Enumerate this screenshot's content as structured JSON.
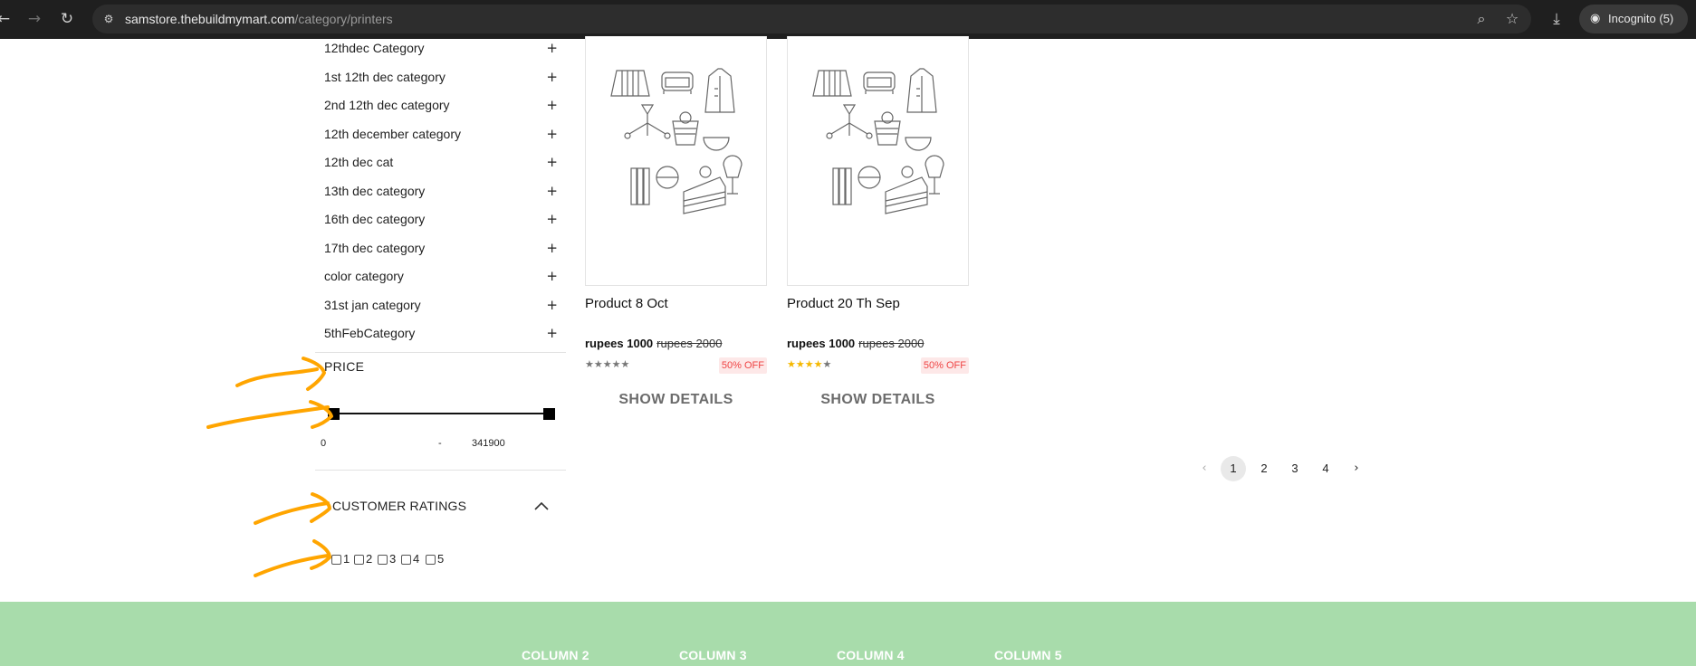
{
  "browser": {
    "url_host": "samstore.thebuildmymart.com",
    "url_path": "/category/printers",
    "incognito_label": "Incognito (5)"
  },
  "sidebar": {
    "categories": [
      {
        "label": "12thdec Category"
      },
      {
        "label": "1st 12th dec category"
      },
      {
        "label": "2nd 12th dec category"
      },
      {
        "label": "12th december category"
      },
      {
        "label": "12th dec cat"
      },
      {
        "label": "13th dec category"
      },
      {
        "label": "16th dec category"
      },
      {
        "label": "17th dec category"
      },
      {
        "label": "color category"
      },
      {
        "label": "31st jan category"
      },
      {
        "label": "5thFebCategory"
      }
    ],
    "expand_symbol": "+",
    "price": {
      "title": "PRICE",
      "min": "0",
      "separator": "-",
      "max": "341900"
    },
    "ratings": {
      "title": "CUSTOMER RATINGS",
      "options": [
        "1",
        "2",
        "3",
        "4",
        "5"
      ]
    }
  },
  "products": [
    {
      "name": "Product 8 Oct",
      "price_now": "rupees 1000",
      "price_was": "rupees 2000",
      "rating": 0,
      "discount": "50% OFF",
      "cta": "SHOW DETAILS"
    },
    {
      "name": "Product 20 Th Sep",
      "price_now": "rupees 1000",
      "price_was": "rupees 2000",
      "rating": 4,
      "discount": "50% OFF",
      "cta": "SHOW DETAILS"
    }
  ],
  "pagination": {
    "prev": "‹",
    "pages": [
      "1",
      "2",
      "3",
      "4"
    ],
    "current": "1",
    "next": "›"
  },
  "footer": {
    "columns": [
      "COLUMN 2",
      "COLUMN 3",
      "COLUMN 4",
      "COLUMN 5"
    ]
  },
  "colors": {
    "footer_bg": "#a8dcab",
    "star_on": "#f5b800",
    "annotation": "#ffa500",
    "discount_text": "#ef4444"
  }
}
